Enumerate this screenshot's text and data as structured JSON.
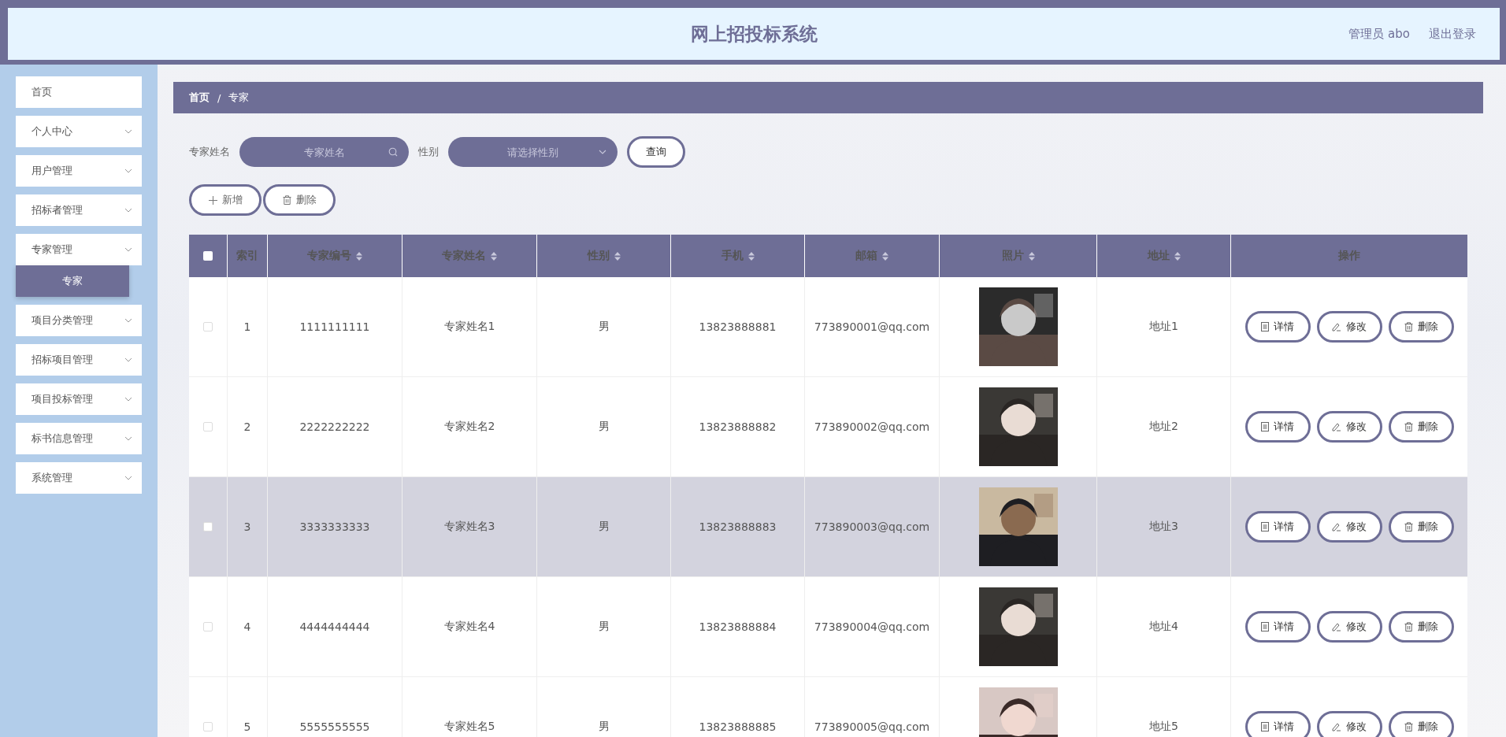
{
  "header": {
    "title": "网上招投标系统",
    "user": "管理员 abo",
    "logout": "退出登录"
  },
  "sidebar": {
    "items": [
      {
        "label": "首页",
        "kind": "link"
      },
      {
        "label": "个人中心",
        "kind": "menu"
      },
      {
        "label": "用户管理",
        "kind": "menu"
      },
      {
        "label": "招标者管理",
        "kind": "menu"
      },
      {
        "label": "专家管理",
        "kind": "menu",
        "expanded": true,
        "children": [
          {
            "label": "专家",
            "selected": true
          }
        ]
      },
      {
        "label": "项目分类管理",
        "kind": "menu"
      },
      {
        "label": "招标项目管理",
        "kind": "menu"
      },
      {
        "label": "项目投标管理",
        "kind": "menu"
      },
      {
        "label": "标书信息管理",
        "kind": "menu"
      },
      {
        "label": "系统管理",
        "kind": "menu"
      }
    ]
  },
  "breadcrumb": [
    "首页",
    "专家"
  ],
  "breadcrumb_separator": "/",
  "search": {
    "name_label": "专家姓名",
    "name_placeholder": "专家姓名",
    "gender_label": "性别",
    "gender_placeholder": "请选择性别",
    "query_button": "查询"
  },
  "actions": [
    "新增",
    "删除"
  ],
  "table": {
    "select_all": {
      "checked": false
    },
    "columns": [
      {
        "label": "索引",
        "sortable": false
      },
      {
        "label": "专家编号",
        "sortable": true
      },
      {
        "label": "专家姓名",
        "sortable": true
      },
      {
        "label": "性别",
        "sortable": true
      },
      {
        "label": "手机",
        "sortable": true
      },
      {
        "label": "邮箱",
        "sortable": true
      },
      {
        "label": "照片",
        "sortable": true
      },
      {
        "label": "地址",
        "sortable": true
      },
      {
        "label": "操作",
        "sortable": false
      }
    ],
    "rows": [
      {
        "index": "1",
        "code": "1111111111",
        "name": "专家姓名1",
        "gender": "男",
        "phone": "13823888881",
        "email": "773890001@qq.com",
        "address": "地址1",
        "buttons": [
          "详情",
          "修改",
          "删除"
        ],
        "checked": false,
        "hovered": false
      },
      {
        "index": "2",
        "code": "2222222222",
        "name": "专家姓名2",
        "gender": "男",
        "phone": "13823888882",
        "email": "773890002@qq.com",
        "address": "地址2",
        "buttons": [
          "详情",
          "修改",
          "删除"
        ],
        "checked": false,
        "hovered": false
      },
      {
        "index": "3",
        "code": "3333333333",
        "name": "专家姓名3",
        "gender": "男",
        "phone": "13823888883",
        "email": "773890003@qq.com",
        "address": "地址3",
        "buttons": [
          "详情",
          "修改",
          "删除"
        ],
        "checked": false,
        "hovered": true
      },
      {
        "index": "4",
        "code": "4444444444",
        "name": "专家姓名4",
        "gender": "男",
        "phone": "13823888884",
        "email": "773890004@qq.com",
        "address": "地址4",
        "buttons": [
          "详情",
          "修改",
          "删除"
        ],
        "checked": false,
        "hovered": false
      },
      {
        "index": "5",
        "code": "5555555555",
        "name": "专家姓名5",
        "gender": "男",
        "phone": "13823888885",
        "email": "773890005@qq.com",
        "address": "地址5",
        "buttons": [
          "详情",
          "修改",
          "删除"
        ],
        "checked": false,
        "hovered": false
      }
    ]
  }
}
